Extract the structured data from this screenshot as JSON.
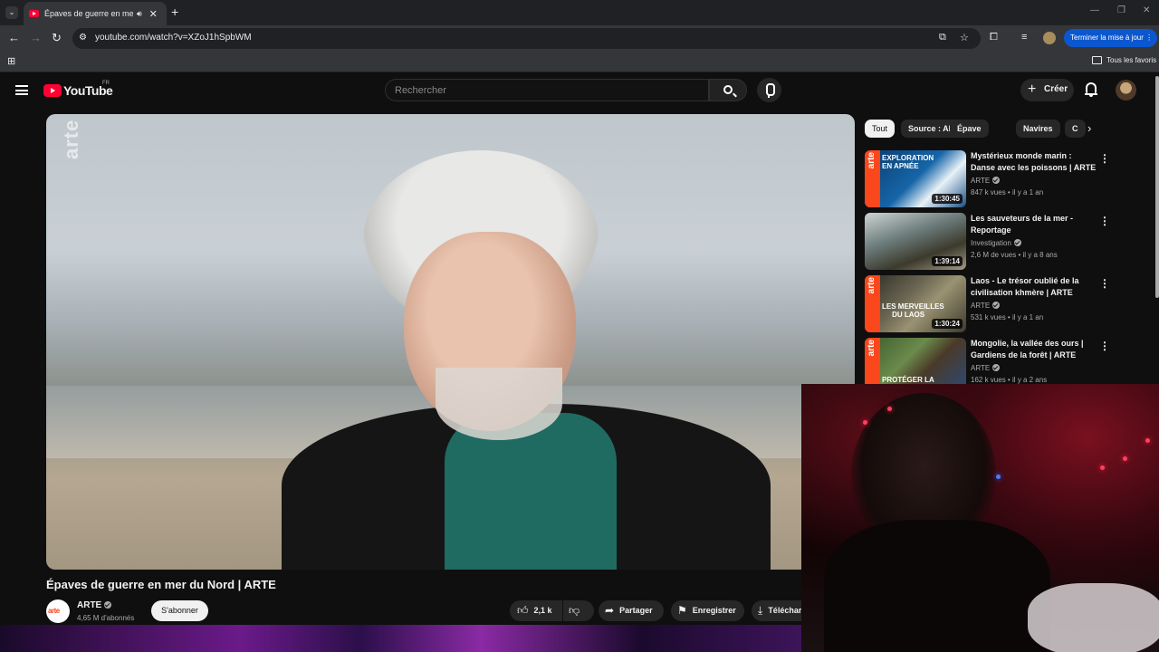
{
  "browser": {
    "tab_title": "Épaves de guerre en mer du",
    "url": "youtube.com/watch?v=XZoJ1hSpbWM",
    "update_button": "Terminer la mise à jour",
    "bookmarks_all": "Tous les favoris"
  },
  "youtube": {
    "logo": "YouTube",
    "country_code": "FR",
    "search_placeholder": "Rechercher",
    "create_label": "Créer"
  },
  "video": {
    "title": "Épaves de guerre en mer du Nord | ARTE",
    "watermark": "arte",
    "channel": {
      "name": "ARTE",
      "avatar_text": "arte",
      "subscribers": "4,65 M d'abonnés"
    },
    "subscribe_label": "S'abonner",
    "likes": "2,1 k",
    "share_label": "Partager",
    "save_label": "Enregistrer",
    "download_label": "Télécharger"
  },
  "chips": [
    "Tout",
    "Source : ARTE",
    "Épave",
    "Navires",
    "C"
  ],
  "recommendations": [
    {
      "title": "Mystérieux monde marin : Danse avec les poissons | ARTE",
      "channel": "ARTE",
      "views": "847 k vues",
      "age": "il y a 1 an",
      "duration": "1:30:45",
      "thumb_text": "EXPLORATION\nEN APNÉE",
      "thumb_color": "#1565a8"
    },
    {
      "title": "Les sauveteurs de la mer - Reportage",
      "channel": "Investigation",
      "views": "2,6 M de vues",
      "age": "il y a 8 ans",
      "duration": "1:39:14",
      "thumb_text": "",
      "thumb_color": "#5a6a6e"
    },
    {
      "title": "Laos - Le trésor oublié de la civilisation khmère | ARTE",
      "channel": "ARTE",
      "views": "531 k vues",
      "age": "il y a 1 an",
      "duration": "1:30:24",
      "thumb_text": "LES MERVEILLES\nDU LAOS",
      "thumb_color": "#5e5a4c"
    },
    {
      "title": "Mongolie, la vallée des ours | Gardiens de la forêt | ARTE",
      "channel": "ARTE",
      "views": "162 k vues",
      "age": "il y a 2 ans",
      "duration": "",
      "thumb_text": "PROTÉGER LA",
      "thumb_color": "#4c6a3a"
    }
  ],
  "colors": {
    "accent_red": "#ff0033",
    "arte_orange": "#fa481c",
    "update_blue": "#0b57d0"
  }
}
